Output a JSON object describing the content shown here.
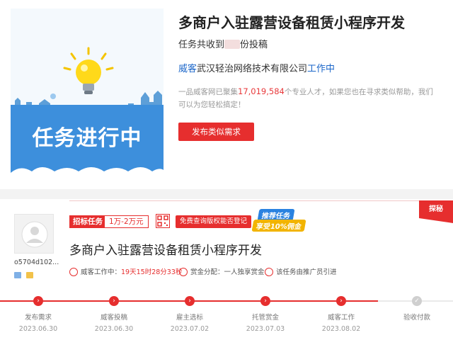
{
  "hero": {
    "banner_text": "任务进行中"
  },
  "task": {
    "title": "多商户入驻露营设备租赁小程序开发",
    "bids_prefix": "任务共收到",
    "bids_suffix": "份投稿",
    "company_prefix": "威客",
    "company_name": "武汉轻治网络技术有限公司",
    "company_suffix": "工作中",
    "desc_prefix": "一品威客网已聚集",
    "desc_count": "17,019,584",
    "desc_suffix": "个专业人才，如果您也在寻求类似帮助，我们可以为您轻松搞定！",
    "post_button": "发布类似需求"
  },
  "detail": {
    "user_id": "o5704d102...",
    "tag_bid": "招标任务",
    "budget": "1万-2万元",
    "free_button": "免费查询版权能否登记",
    "promo_line1": "推荐任务",
    "promo_line2": "享受10%佣金",
    "ribbon": "探秘",
    "title": "多商户入驻露营设备租赁小程序开发",
    "status_label": "威客工作中：",
    "status_time": "19天15时28分33秒",
    "reward_label": "赏金分配：一人独享赏金",
    "promo_note": "该任务由推广员引进"
  },
  "progress": {
    "fraction_complete": 0.835,
    "steps": [
      {
        "label": "发布需求",
        "date": "2023.06.30",
        "done": true
      },
      {
        "label": "威客投稿",
        "date": "2023.06.30",
        "done": true
      },
      {
        "label": "雇主选标",
        "date": "2023.07.02",
        "done": true
      },
      {
        "label": "托管赏金",
        "date": "2023.07.03",
        "done": true
      },
      {
        "label": "威客工作",
        "date": "2023.08.02",
        "done": true
      },
      {
        "label": "验收付款",
        "date": "",
        "done": false
      }
    ]
  },
  "colors": {
    "accent": "#e62e2e",
    "link": "#1b66c9",
    "hero_blue": "#3d8fdc"
  }
}
